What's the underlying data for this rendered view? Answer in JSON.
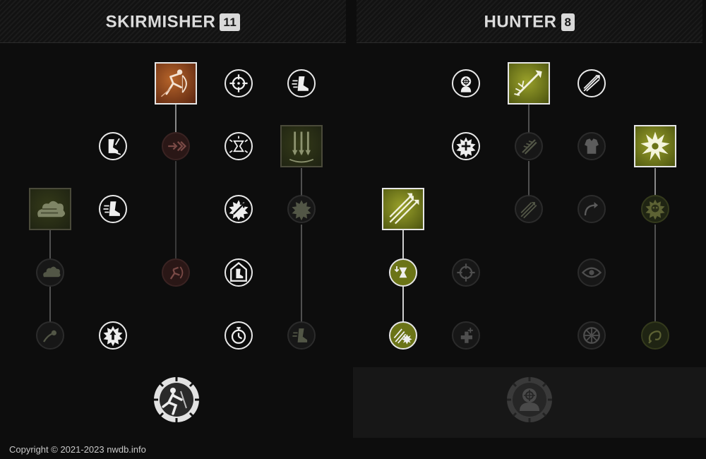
{
  "trees": {
    "left": {
      "name": "SKIRMISHER",
      "points": "11"
    },
    "right": {
      "name": "HUNTER",
      "points": "8"
    }
  },
  "skirmisher_nodes": [
    {
      "icon": "archer-leap-icon",
      "shape": "square",
      "state": "active-orange"
    },
    {
      "icon": "crosshair-icon",
      "shape": "circle",
      "state": "active"
    },
    {
      "icon": "running-boot-icon",
      "shape": "circle",
      "state": "active"
    },
    {
      "icon": "boot-arrow-icon",
      "shape": "circle",
      "state": "active"
    },
    {
      "icon": "chevron-arrows-icon",
      "shape": "circle",
      "state": "inactive-brown"
    },
    {
      "icon": "hourglass-burst-icon",
      "shape": "circle",
      "state": "active"
    },
    {
      "icon": "triple-arrows-icon",
      "shape": "square",
      "state": "inactive-olive"
    },
    {
      "icon": "smoke-cloud-icon",
      "shape": "square",
      "state": "inactive-olive"
    },
    {
      "icon": "speed-boot-icon",
      "shape": "circle",
      "state": "active"
    },
    {
      "icon": "arrow-burst-icon",
      "shape": "circle",
      "state": "active"
    },
    {
      "icon": "spiked-burst-icon",
      "shape": "circle",
      "state": "inactive"
    },
    {
      "icon": "cloud-burst-icon",
      "shape": "circle",
      "state": "inactive"
    },
    {
      "icon": "archer-shadow-icon",
      "shape": "circle",
      "state": "inactive-brown"
    },
    {
      "icon": "boot-shield-icon",
      "shape": "circle",
      "state": "active"
    },
    {
      "icon": "comet-icon",
      "shape": "circle",
      "state": "inactive"
    },
    {
      "icon": "star-arrow-icon",
      "shape": "circle",
      "state": "active"
    },
    {
      "icon": "stopwatch-icon",
      "shape": "circle",
      "state": "active"
    },
    {
      "icon": "boot-trail-icon",
      "shape": "circle",
      "state": "inactive"
    }
  ],
  "hunter_nodes": [
    {
      "icon": "target-head-icon",
      "shape": "circle",
      "state": "active"
    },
    {
      "icon": "piercing-arrow-icon",
      "shape": "square",
      "state": "active-olive"
    },
    {
      "icon": "three-arrows-icon",
      "shape": "circle",
      "state": "active"
    },
    {
      "icon": "snowflake-burst-icon",
      "shape": "circle",
      "state": "active"
    },
    {
      "icon": "feathered-arrows-icon",
      "shape": "circle",
      "state": "inactive"
    },
    {
      "icon": "armor-vest-icon",
      "shape": "circle",
      "state": "inactive"
    },
    {
      "icon": "explosion-icon",
      "shape": "square",
      "state": "active-olive"
    },
    {
      "icon": "rain-of-arrows-icon",
      "shape": "square",
      "state": "active-olive"
    },
    {
      "icon": "arrows-flurry-icon",
      "shape": "circle",
      "state": "inactive"
    },
    {
      "icon": "curved-arrow-icon",
      "shape": "circle",
      "state": "inactive"
    },
    {
      "icon": "skull-fire-icon",
      "shape": "circle",
      "state": "inactive-olive"
    },
    {
      "icon": "hourglass-arrow-icon",
      "shape": "circle",
      "state": "active-olive"
    },
    {
      "icon": "scope-icon",
      "shape": "circle",
      "state": "inactive"
    },
    {
      "icon": "eye-icon",
      "shape": "circle",
      "state": "inactive"
    },
    {
      "icon": "arrow-explosion-icon",
      "shape": "circle",
      "state": "active-olive"
    },
    {
      "icon": "health-plus-icon",
      "shape": "circle",
      "state": "inactive"
    },
    {
      "icon": "wheel-icon",
      "shape": "circle",
      "state": "inactive"
    },
    {
      "icon": "hook-swirl-icon",
      "shape": "circle",
      "state": "inactive-olive"
    }
  ],
  "ultimates": {
    "left": {
      "icon": "sprinting-archer-icon",
      "state": "active"
    },
    "right": {
      "icon": "marked-head-gear-icon",
      "state": "inactive"
    }
  },
  "footer": {
    "copyright": "Copyright © 2021-2023 nwdb.info"
  }
}
